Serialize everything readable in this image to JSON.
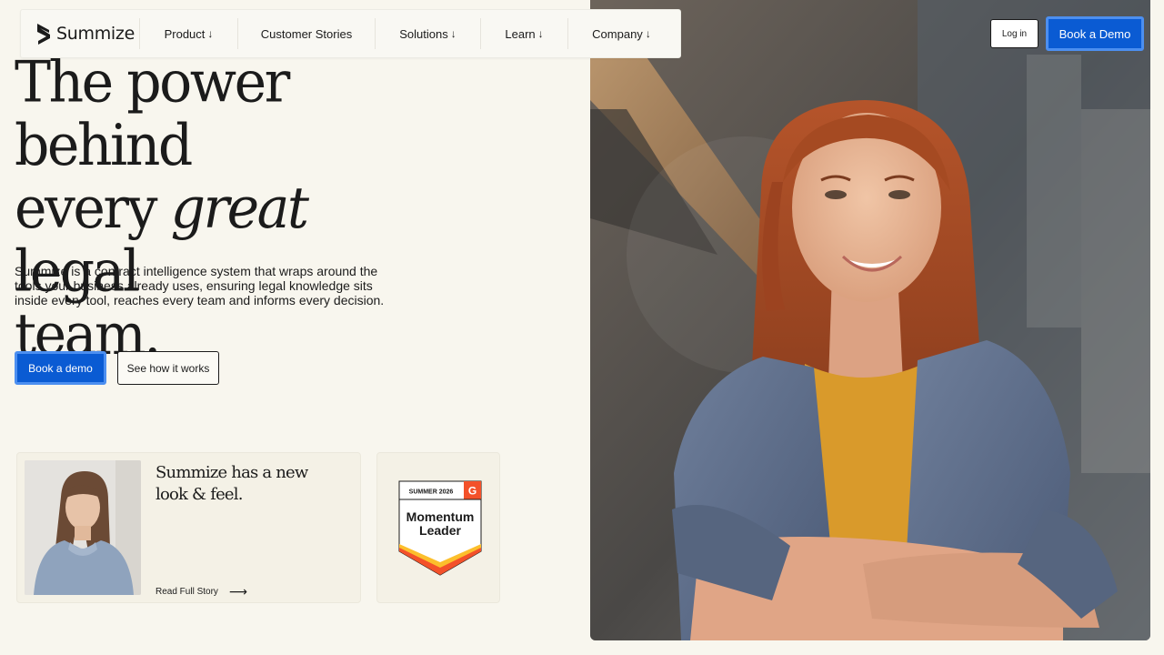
{
  "brand": {
    "name": "Summize"
  },
  "nav": {
    "items": [
      {
        "label": "Product",
        "has_dropdown": true
      },
      {
        "label": "Customer Stories",
        "has_dropdown": false
      },
      {
        "label": "Solutions",
        "has_dropdown": true
      },
      {
        "label": "Learn",
        "has_dropdown": true
      },
      {
        "label": "Company",
        "has_dropdown": true
      }
    ],
    "dropdown_arrow": "↓",
    "login_label": "Log in",
    "demo_label": "Book a Demo"
  },
  "hero": {
    "title_line1": "The power behind",
    "title_line2_pre": "every ",
    "title_line2_em": "great",
    "title_line2_post": " legal",
    "title_line3": "team.",
    "description": "Summize is a contract intelligence system that wraps around the tools your business already uses, ensuring legal knowledge sits inside every tool, reaches every team and informs every decision.",
    "primary_cta": "Book a demo",
    "secondary_cta": "See how it works"
  },
  "story": {
    "title": "Summize has a new look & feel.",
    "link_label": "Read Full Story",
    "link_arrow": "⟶"
  },
  "badge": {
    "season": "SUMMER 2026",
    "title_line1": "Momentum",
    "title_line2": "Leader",
    "logo": "G"
  },
  "colors": {
    "accent_blue": "#0a5bd3",
    "accent_blue_border": "#4c8ff0",
    "background": "#f8f6ee",
    "badge_orange": "#f3512a",
    "badge_yellow": "#fcbf2c"
  },
  "icons": {
    "brand_logo": "summize-s-logo-icon",
    "link_arrow": "arrow-right-icon"
  }
}
